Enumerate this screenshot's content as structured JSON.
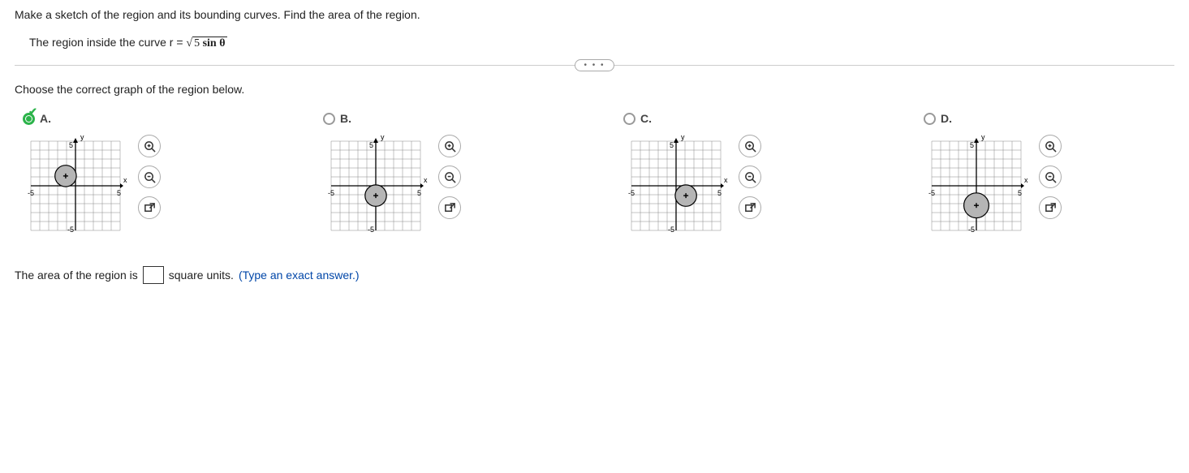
{
  "question": {
    "main": "Make a sketch of the region and its bounding curves. Find the area of the region.",
    "sub_prefix": "The region inside the curve r = ",
    "sqrt_value": "5",
    "sqrt_after": " sin θ"
  },
  "ellipsis": "• • •",
  "choose_text": "Choose the correct graph of the region below.",
  "choices": [
    {
      "label": "A.",
      "selected": true,
      "correct": true
    },
    {
      "label": "B.",
      "selected": false,
      "correct": false
    },
    {
      "label": "C.",
      "selected": false,
      "correct": false
    },
    {
      "label": "D.",
      "selected": false,
      "correct": false
    }
  ],
  "answer": {
    "prefix": "The area of the region is ",
    "value": "",
    "suffix": " square units. ",
    "hint": "(Type an exact answer.)"
  },
  "chart_data": [
    {
      "type": "polar_region",
      "title": "Choice A",
      "xlabel": "x",
      "ylabel": "y",
      "xlim": [
        -5,
        5
      ],
      "ylim": [
        -5,
        5
      ],
      "grid": true,
      "region": {
        "shape": "circle",
        "cx": -1.1,
        "cy": 1.1,
        "r": 1.2
      },
      "marker": {
        "x": -1.1,
        "y": 1.1
      }
    },
    {
      "type": "polar_region",
      "title": "Choice B",
      "xlabel": "x",
      "ylabel": "y",
      "xlim": [
        -5,
        5
      ],
      "ylim": [
        -5,
        5
      ],
      "grid": true,
      "region": {
        "shape": "circle",
        "cx": 0,
        "cy": -1.1,
        "r": 1.2
      },
      "marker": {
        "x": 0,
        "y": -1.1
      }
    },
    {
      "type": "polar_region",
      "title": "Choice C",
      "xlabel": "x",
      "ylabel": "y",
      "xlim": [
        -5,
        5
      ],
      "ylim": [
        -5,
        5
      ],
      "grid": true,
      "region": {
        "shape": "circle",
        "cx": 1.1,
        "cy": -1.1,
        "r": 1.2
      },
      "marker": {
        "x": 1.1,
        "y": -1.1
      }
    },
    {
      "type": "polar_region",
      "title": "Choice D",
      "xlabel": "x",
      "ylabel": "y",
      "xlim": [
        -5,
        5
      ],
      "ylim": [
        -5,
        5
      ],
      "grid": true,
      "region": {
        "shape": "circle",
        "cx": 0,
        "cy": -2.2,
        "r": 1.4
      },
      "marker": {
        "x": 0,
        "y": -2.2
      }
    }
  ]
}
